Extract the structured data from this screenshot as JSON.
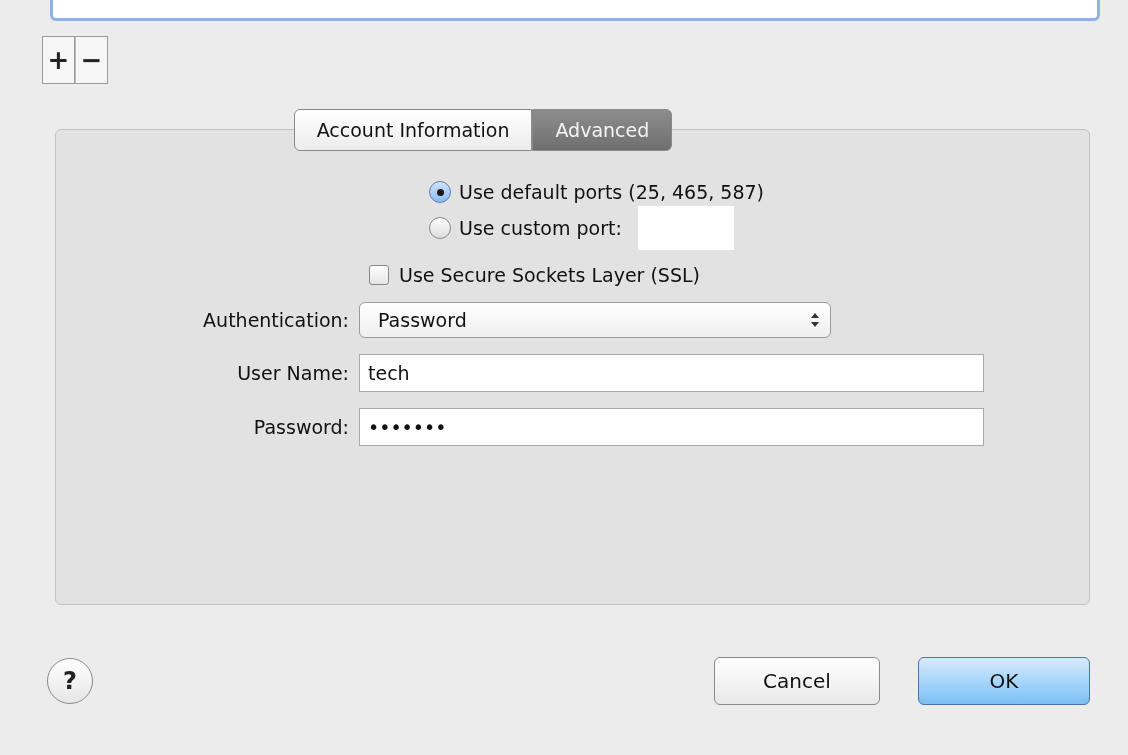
{
  "list_buttons": [
    "+",
    "−"
  ],
  "tabs": [
    {
      "label": "Account Information",
      "selected": false
    },
    {
      "label": "Advanced",
      "selected": true
    }
  ],
  "port_options": [
    {
      "label": "Use default ports (25, 465, 587)",
      "selected": true,
      "kind": "plain"
    },
    {
      "label": "Use custom port:",
      "selected": false,
      "kind": "field"
    }
  ],
  "ssl": {
    "label": "Use Secure Sockets Layer (SSL)",
    "checked": false
  },
  "authentication": {
    "label": "Authentication:",
    "value": "Password"
  },
  "user_name": {
    "label": "User Name:",
    "value": "tech"
  },
  "password": {
    "label": "Password:",
    "value": "•••••••"
  },
  "help": "?",
  "buttons": [
    {
      "label": "Cancel",
      "kind": "secondary"
    },
    {
      "label": "OK",
      "kind": "default"
    }
  ]
}
